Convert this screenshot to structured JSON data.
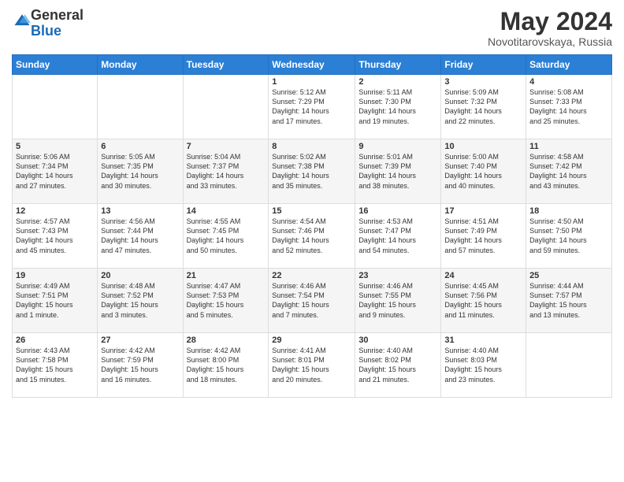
{
  "logo": {
    "general": "General",
    "blue": "Blue"
  },
  "title": {
    "month_year": "May 2024",
    "location": "Novotitarovskaya, Russia"
  },
  "weekdays": [
    "Sunday",
    "Monday",
    "Tuesday",
    "Wednesday",
    "Thursday",
    "Friday",
    "Saturday"
  ],
  "weeks": [
    [
      {
        "day": "",
        "content": ""
      },
      {
        "day": "",
        "content": ""
      },
      {
        "day": "",
        "content": ""
      },
      {
        "day": "1",
        "content": "Sunrise: 5:12 AM\nSunset: 7:29 PM\nDaylight: 14 hours\nand 17 minutes."
      },
      {
        "day": "2",
        "content": "Sunrise: 5:11 AM\nSunset: 7:30 PM\nDaylight: 14 hours\nand 19 minutes."
      },
      {
        "day": "3",
        "content": "Sunrise: 5:09 AM\nSunset: 7:32 PM\nDaylight: 14 hours\nand 22 minutes."
      },
      {
        "day": "4",
        "content": "Sunrise: 5:08 AM\nSunset: 7:33 PM\nDaylight: 14 hours\nand 25 minutes."
      }
    ],
    [
      {
        "day": "5",
        "content": "Sunrise: 5:06 AM\nSunset: 7:34 PM\nDaylight: 14 hours\nand 27 minutes."
      },
      {
        "day": "6",
        "content": "Sunrise: 5:05 AM\nSunset: 7:35 PM\nDaylight: 14 hours\nand 30 minutes."
      },
      {
        "day": "7",
        "content": "Sunrise: 5:04 AM\nSunset: 7:37 PM\nDaylight: 14 hours\nand 33 minutes."
      },
      {
        "day": "8",
        "content": "Sunrise: 5:02 AM\nSunset: 7:38 PM\nDaylight: 14 hours\nand 35 minutes."
      },
      {
        "day": "9",
        "content": "Sunrise: 5:01 AM\nSunset: 7:39 PM\nDaylight: 14 hours\nand 38 minutes."
      },
      {
        "day": "10",
        "content": "Sunrise: 5:00 AM\nSunset: 7:40 PM\nDaylight: 14 hours\nand 40 minutes."
      },
      {
        "day": "11",
        "content": "Sunrise: 4:58 AM\nSunset: 7:42 PM\nDaylight: 14 hours\nand 43 minutes."
      }
    ],
    [
      {
        "day": "12",
        "content": "Sunrise: 4:57 AM\nSunset: 7:43 PM\nDaylight: 14 hours\nand 45 minutes."
      },
      {
        "day": "13",
        "content": "Sunrise: 4:56 AM\nSunset: 7:44 PM\nDaylight: 14 hours\nand 47 minutes."
      },
      {
        "day": "14",
        "content": "Sunrise: 4:55 AM\nSunset: 7:45 PM\nDaylight: 14 hours\nand 50 minutes."
      },
      {
        "day": "15",
        "content": "Sunrise: 4:54 AM\nSunset: 7:46 PM\nDaylight: 14 hours\nand 52 minutes."
      },
      {
        "day": "16",
        "content": "Sunrise: 4:53 AM\nSunset: 7:47 PM\nDaylight: 14 hours\nand 54 minutes."
      },
      {
        "day": "17",
        "content": "Sunrise: 4:51 AM\nSunset: 7:49 PM\nDaylight: 14 hours\nand 57 minutes."
      },
      {
        "day": "18",
        "content": "Sunrise: 4:50 AM\nSunset: 7:50 PM\nDaylight: 14 hours\nand 59 minutes."
      }
    ],
    [
      {
        "day": "19",
        "content": "Sunrise: 4:49 AM\nSunset: 7:51 PM\nDaylight: 15 hours\nand 1 minute."
      },
      {
        "day": "20",
        "content": "Sunrise: 4:48 AM\nSunset: 7:52 PM\nDaylight: 15 hours\nand 3 minutes."
      },
      {
        "day": "21",
        "content": "Sunrise: 4:47 AM\nSunset: 7:53 PM\nDaylight: 15 hours\nand 5 minutes."
      },
      {
        "day": "22",
        "content": "Sunrise: 4:46 AM\nSunset: 7:54 PM\nDaylight: 15 hours\nand 7 minutes."
      },
      {
        "day": "23",
        "content": "Sunrise: 4:46 AM\nSunset: 7:55 PM\nDaylight: 15 hours\nand 9 minutes."
      },
      {
        "day": "24",
        "content": "Sunrise: 4:45 AM\nSunset: 7:56 PM\nDaylight: 15 hours\nand 11 minutes."
      },
      {
        "day": "25",
        "content": "Sunrise: 4:44 AM\nSunset: 7:57 PM\nDaylight: 15 hours\nand 13 minutes."
      }
    ],
    [
      {
        "day": "26",
        "content": "Sunrise: 4:43 AM\nSunset: 7:58 PM\nDaylight: 15 hours\nand 15 minutes."
      },
      {
        "day": "27",
        "content": "Sunrise: 4:42 AM\nSunset: 7:59 PM\nDaylight: 15 hours\nand 16 minutes."
      },
      {
        "day": "28",
        "content": "Sunrise: 4:42 AM\nSunset: 8:00 PM\nDaylight: 15 hours\nand 18 minutes."
      },
      {
        "day": "29",
        "content": "Sunrise: 4:41 AM\nSunset: 8:01 PM\nDaylight: 15 hours\nand 20 minutes."
      },
      {
        "day": "30",
        "content": "Sunrise: 4:40 AM\nSunset: 8:02 PM\nDaylight: 15 hours\nand 21 minutes."
      },
      {
        "day": "31",
        "content": "Sunrise: 4:40 AM\nSunset: 8:03 PM\nDaylight: 15 hours\nand 23 minutes."
      },
      {
        "day": "",
        "content": ""
      }
    ]
  ]
}
